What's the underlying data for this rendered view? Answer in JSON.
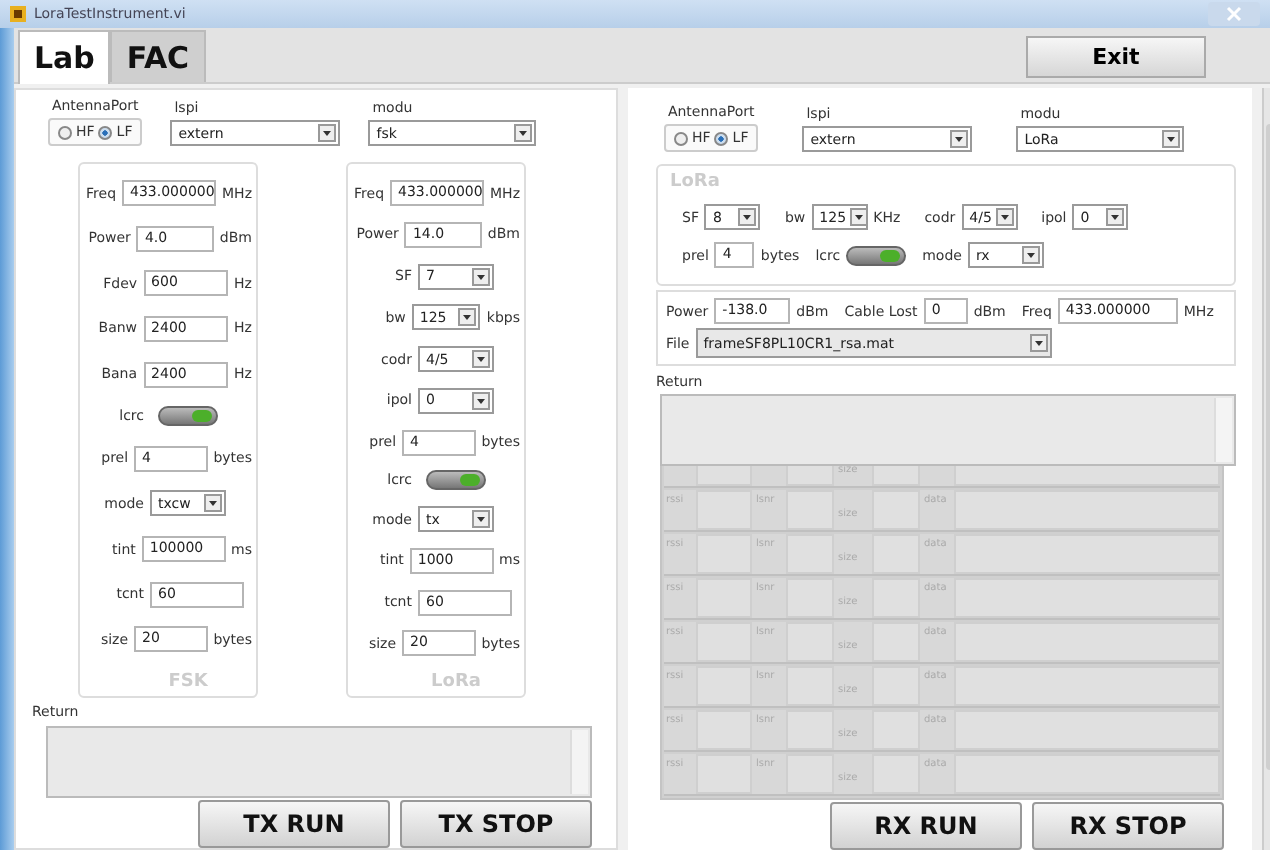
{
  "window": {
    "title": "LoraTestInstrument.vi"
  },
  "tabs": [
    {
      "label": "Lab",
      "selected": true
    },
    {
      "label": "FAC",
      "selected": false
    }
  ],
  "exit_button": "Exit",
  "tx_panel": {
    "antenna_port": {
      "label": "AntennaPort",
      "options": [
        {
          "label": "HF",
          "selected": false
        },
        {
          "label": "LF",
          "selected": true
        }
      ]
    },
    "lspi": {
      "label": "lspi",
      "value": "extern"
    },
    "modu": {
      "label": "modu",
      "value": "fsk"
    },
    "cards": [
      {
        "title": "FSK",
        "fields": [
          {
            "kind": "text",
            "label": "Freq",
            "value": "433.000000",
            "unit": "MHz"
          },
          {
            "kind": "text",
            "label": "Power",
            "value": "4.0",
            "unit": "dBm"
          },
          {
            "kind": "text",
            "label": "Fdev",
            "value": "600",
            "unit": "Hz"
          },
          {
            "kind": "text",
            "label": "Banw",
            "value": "2400",
            "unit": "Hz"
          },
          {
            "kind": "text",
            "label": "Bana",
            "value": "2400",
            "unit": "Hz"
          },
          {
            "kind": "toggle",
            "label": "lcrc",
            "on": true
          },
          {
            "kind": "text",
            "label": "prel",
            "value": "4",
            "unit": "bytes"
          },
          {
            "kind": "dropdown",
            "label": "mode",
            "value": "txcw"
          },
          {
            "kind": "text",
            "label": "tint",
            "value": "100000",
            "unit": "ms"
          },
          {
            "kind": "text",
            "label": "tcnt",
            "value": "60"
          },
          {
            "kind": "text",
            "label": "size",
            "value": "20",
            "unit": "bytes"
          }
        ]
      },
      {
        "title": "LoRa",
        "fields": [
          {
            "kind": "text",
            "label": "Freq",
            "value": "433.000000",
            "unit": "MHz"
          },
          {
            "kind": "text",
            "label": "Power",
            "value": "14.0",
            "unit": "dBm"
          },
          {
            "kind": "dropdown",
            "label": "SF",
            "value": "7"
          },
          {
            "kind": "dropdown",
            "label": "bw",
            "value": "125",
            "unit": "kbps"
          },
          {
            "kind": "dropdown",
            "label": "codr",
            "value": "4/5"
          },
          {
            "kind": "dropdown",
            "label": "ipol",
            "value": "0"
          },
          {
            "kind": "text",
            "label": "prel",
            "value": "4",
            "unit": "bytes"
          },
          {
            "kind": "toggle",
            "label": "lcrc",
            "on": true
          },
          {
            "kind": "dropdown",
            "label": "mode",
            "value": "tx"
          },
          {
            "kind": "text",
            "label": "tint",
            "value": "1000",
            "unit": "ms"
          },
          {
            "kind": "text",
            "label": "tcnt",
            "value": "60"
          },
          {
            "kind": "text",
            "label": "size",
            "value": "20",
            "unit": "bytes"
          }
        ]
      }
    ],
    "return_label": "Return",
    "buttons": [
      "TX RUN",
      "TX STOP"
    ]
  },
  "rx_panel": {
    "antenna_port": {
      "label": "AntennaPort",
      "options": [
        {
          "label": "HF",
          "selected": false
        },
        {
          "label": "LF",
          "selected": true
        }
      ]
    },
    "lspi": {
      "label": "lspi",
      "value": "extern"
    },
    "modu": {
      "label": "modu",
      "value": "LoRa"
    },
    "lora_group": {
      "title": "LoRa",
      "rows": [
        [
          {
            "kind": "dropdown",
            "label": "SF",
            "value": "8"
          },
          {
            "kind": "dropdown",
            "label": "bw",
            "value": "125",
            "unit": "KHz"
          },
          {
            "kind": "dropdown",
            "label": "codr",
            "value": "4/5"
          },
          {
            "kind": "dropdown",
            "label": "ipol",
            "value": "0"
          }
        ],
        [
          {
            "kind": "text",
            "label": "prel",
            "value": "4",
            "unit": "bytes"
          },
          {
            "kind": "toggle",
            "label": "lcrc",
            "on": true
          },
          {
            "kind": "dropdown",
            "label": "mode",
            "value": "rx"
          }
        ]
      ]
    },
    "measure": [
      {
        "label": "Power",
        "value": "-138.0",
        "unit": "dBm"
      },
      {
        "label": "Cable Lost",
        "value": "0",
        "unit": "dBm"
      },
      {
        "label": "Freq",
        "value": "433.000000",
        "unit": "MHz"
      }
    ],
    "file": {
      "label": "File",
      "value": "frameSF8PL10CR1_rsa.mat"
    },
    "return_label": "Return",
    "receive_rows": [
      {
        "size": "size"
      },
      {
        "rssi": "rssi",
        "lsnr": "lsnr",
        "size": "size",
        "data": "data"
      },
      {
        "rssi": "rssi",
        "lsnr": "lsnr",
        "size": "size",
        "data": "data"
      },
      {
        "rssi": "rssi",
        "lsnr": "lsnr",
        "size": "size",
        "data": "data"
      },
      {
        "rssi": "rssi",
        "lsnr": "lsnr",
        "size": "size",
        "data": "data"
      },
      {
        "rssi": "rssi",
        "lsnr": "lsnr",
        "size": "size",
        "data": "data"
      },
      {
        "rssi": "rssi",
        "lsnr": "lsnr",
        "size": "size",
        "data": "data"
      },
      {
        "rssi": "rssi",
        "lsnr": "lsnr",
        "size": "size",
        "data": "data"
      }
    ],
    "buttons": [
      "RX RUN",
      "RX STOP"
    ]
  }
}
